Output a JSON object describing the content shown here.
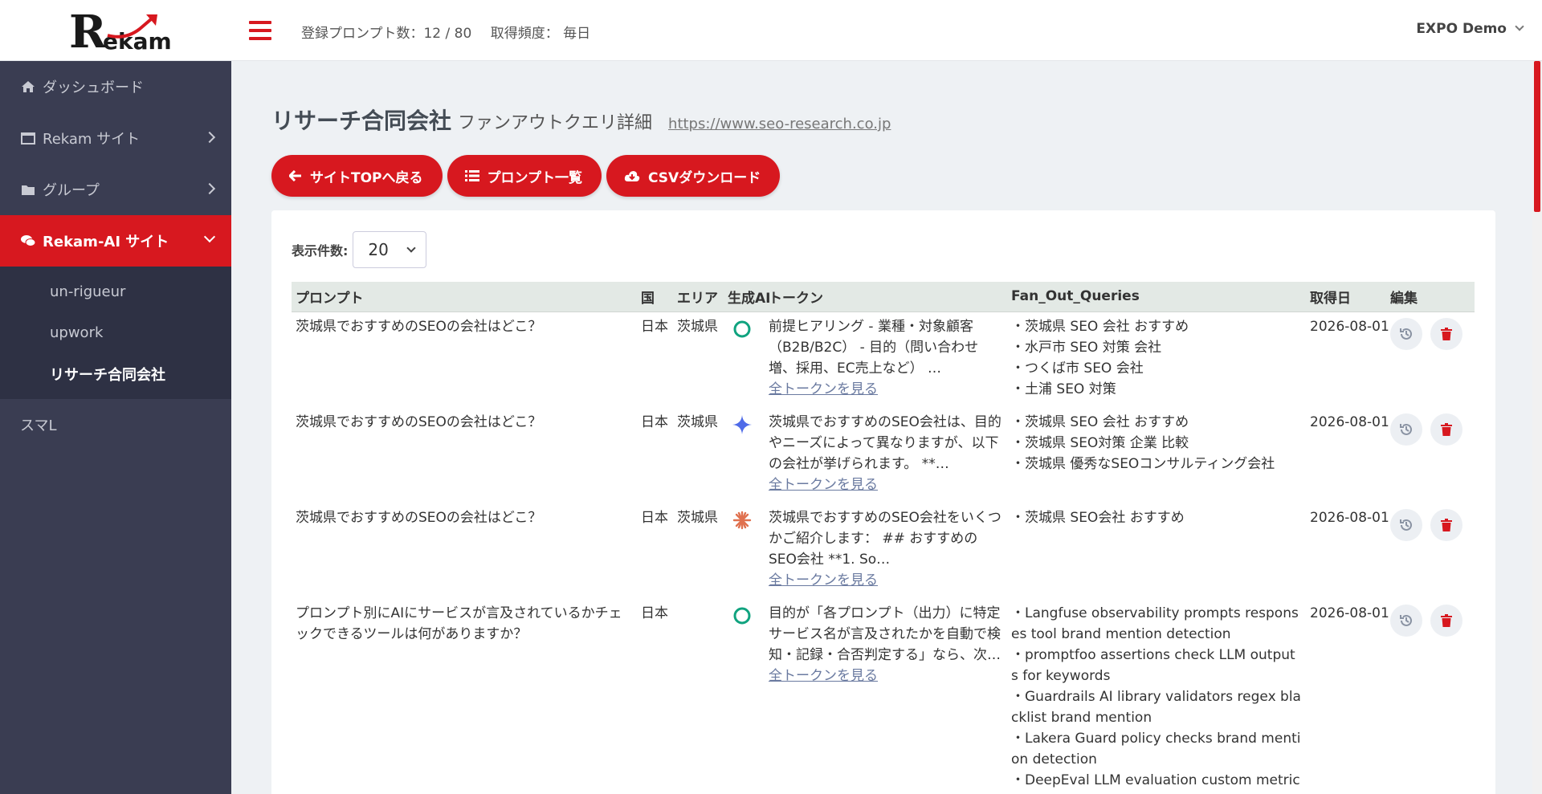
{
  "header": {
    "logo_text": "Rekam",
    "prompt_count": "登録プロンプト数：12 / 80",
    "frequency": "取得頻度： 毎日",
    "user": "EXPO Demo"
  },
  "sidebar": {
    "items": [
      {
        "label": "ダッシュボード",
        "icon": "home-icon"
      },
      {
        "label": "Rekam サイト",
        "icon": "window-icon"
      },
      {
        "label": "グループ",
        "icon": "folder-icon"
      },
      {
        "label": "Rekam-AI サイト",
        "icon": "chat-icon"
      }
    ],
    "subitems": [
      "un-rigueur",
      "upwork",
      "リサーチ合同会社"
    ],
    "plain_item": "スマL"
  },
  "page": {
    "company": "リサーチ合同会社",
    "subtitle": "ファンアウトクエリ詳細",
    "url": "https://www.seo-research.co.jp"
  },
  "buttons": {
    "back": "サイトTOPへ戻る",
    "prompts": "プロンプト一覧",
    "csv": "CSVダウンロード"
  },
  "per_page": {
    "label": "表示件数:",
    "value": "20"
  },
  "table": {
    "headers": [
      "プロンプト",
      "国",
      "エリア",
      "生成AI",
      "トークン",
      "Fan_Out_Queries",
      "取得日",
      "編集"
    ],
    "view_all": "全トークンを見る",
    "rows": [
      {
        "prompt": "茨城県でおすすめのSEOの会社はどこ？",
        "country": "日本",
        "area": "茨城県",
        "ai": "chatgpt-icon",
        "token": "前提ヒアリング - 業種・対象顧客（B2B/B2C） - 目的（問い合わせ増、採用、EC売上など） …",
        "queries": [
          "・茨城県 SEO 会社 おすすめ",
          "・水戸市 SEO 対策 会社",
          "・つくば市 SEO 会社",
          "・土浦 SEO 対策"
        ],
        "date": "2026-08-01"
      },
      {
        "prompt": "茨城県でおすすめのSEOの会社はどこ？",
        "country": "日本",
        "area": "茨城県",
        "ai": "gemini-icon",
        "token": "茨城県でおすすめのSEO会社は、目的やニーズによって異なりますが、以下の会社が挙げられます。 **…",
        "queries": [
          "・茨城県 SEO 会社 おすすめ",
          "・茨城県 SEO対策 企業 比較",
          "・茨城県 優秀なSEOコンサルティング会社"
        ],
        "date": "2026-08-01"
      },
      {
        "prompt": "茨城県でおすすめのSEOの会社はどこ？",
        "country": "日本",
        "area": "茨城県",
        "ai": "claude-icon",
        "token": "茨城県でおすすめのSEO会社をいくつかご紹介します： ## おすすめのSEO会社 **1. So…",
        "queries": [
          "・茨城県 SEO会社 おすすめ"
        ],
        "date": "2026-08-01"
      },
      {
        "prompt": "プロンプト別にAIにサービスが言及されているかチェックできるツールは何がありますか？",
        "country": "日本",
        "area": "",
        "ai": "chatgpt-icon",
        "token": "目的が「各プロンプト（出力）に特定サービス名が言及されたかを自動で検知・記録・合否判定する」なら、次…",
        "queries": [
          "・Langfuse observability prompts responses tool brand mention detection",
          "・promptfoo assertions check LLM outputs for keywords",
          "・Guardrails AI library validators regex blacklist brand mention",
          "・Lakera Guard policy checks brand mention detection",
          "・DeepEval LLM evaluation custom metrics c"
        ],
        "date": "2026-08-01"
      }
    ]
  },
  "colors": {
    "accent": "#d7181f",
    "sidebar": "#3a3d52",
    "chatgpt": "#10a37f",
    "gemini": "#4f6be8",
    "claude": "#e0714f"
  }
}
